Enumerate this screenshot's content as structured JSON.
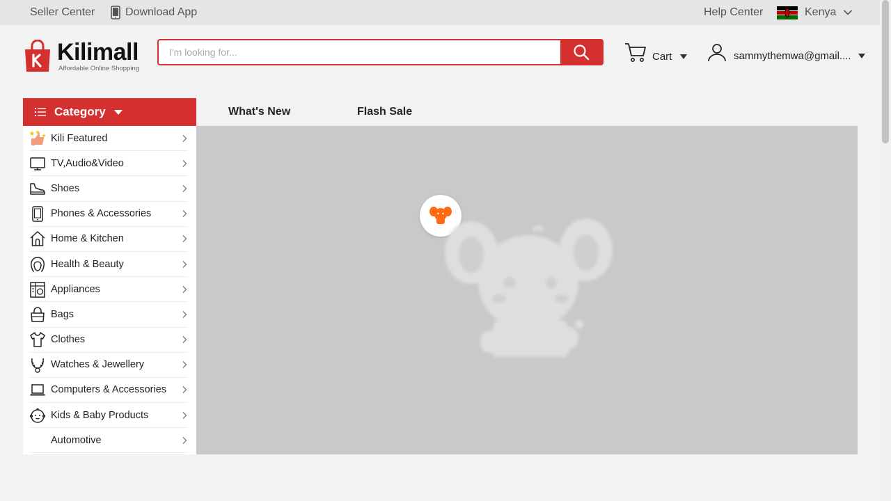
{
  "topbar": {
    "seller_center": "Seller Center",
    "download_app": "Download App",
    "help_center": "Help Center",
    "country": "Kenya"
  },
  "header": {
    "logo_name": "Kilimall",
    "logo_tagline": "Affordable Online Shopping",
    "search_placeholder": "I'm looking for...",
    "search_value": "",
    "cart_label": "Cart",
    "user_label": "sammythemwa@gmail...."
  },
  "nav": {
    "category_label": "Category",
    "links": [
      "What's New",
      "Flash Sale"
    ]
  },
  "categories": [
    {
      "label": "Kili Featured",
      "icon": "thumbs-up-stars-icon"
    },
    {
      "label": "TV,Audio&Video",
      "icon": "tv-icon"
    },
    {
      "label": "Shoes",
      "icon": "shoe-icon"
    },
    {
      "label": "Phones & Accessories",
      "icon": "phone-icon"
    },
    {
      "label": "Home & Kitchen",
      "icon": "home-icon"
    },
    {
      "label": "Health & Beauty",
      "icon": "face-icon"
    },
    {
      "label": "Appliances",
      "icon": "appliance-icon"
    },
    {
      "label": "Bags",
      "icon": "bag-icon"
    },
    {
      "label": "Clothes",
      "icon": "shirt-icon"
    },
    {
      "label": "Watches & Jewellery",
      "icon": "necklace-icon"
    },
    {
      "label": "Computers & Accessories",
      "icon": "laptop-icon"
    },
    {
      "label": "Kids & Baby Products",
      "icon": "baby-icon"
    },
    {
      "label": "Automotive",
      "icon": ""
    }
  ],
  "colors": {
    "brand_red": "#d3302f",
    "loader_orange": "#ff6a13"
  }
}
